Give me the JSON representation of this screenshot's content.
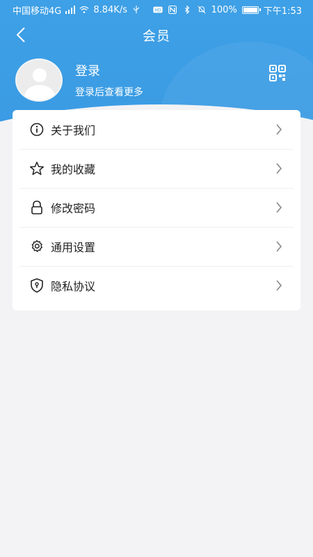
{
  "status_bar": {
    "carrier": "中国移动4G",
    "network_speed": "8.84K/s",
    "battery": "100%",
    "time": "下午1:53"
  },
  "header": {
    "title": "会员"
  },
  "profile": {
    "login_label": "登录",
    "login_hint": "登录后查看更多"
  },
  "menu": [
    {
      "label": "关于我们",
      "icon": "info-icon"
    },
    {
      "label": "我的收藏",
      "icon": "star-icon"
    },
    {
      "label": "修改密码",
      "icon": "lock-icon"
    },
    {
      "label": "通用设置",
      "icon": "gear-icon"
    },
    {
      "label": "隐私协议",
      "icon": "shield-icon"
    }
  ],
  "colors": {
    "header_blue": "#3ea0e6",
    "background": "#f3f3f5"
  }
}
